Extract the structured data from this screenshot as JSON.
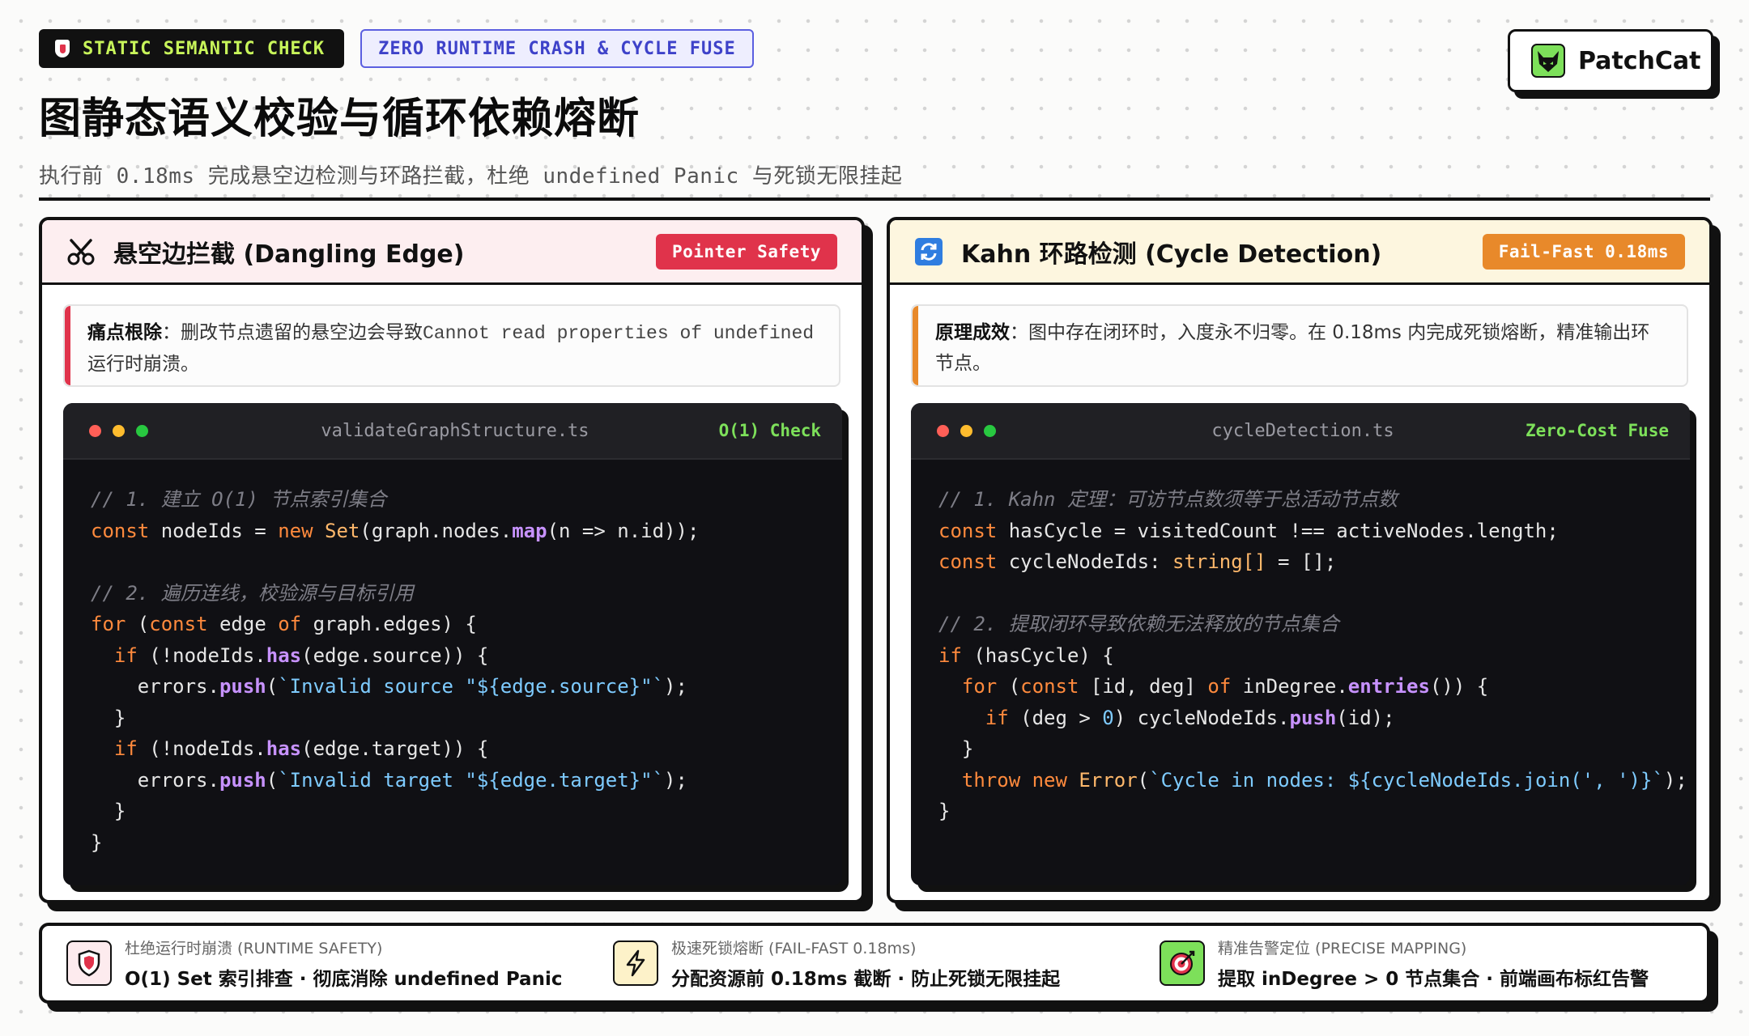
{
  "header": {
    "tag_primary": "STATIC SEMANTIC CHECK",
    "tag_secondary": "ZERO RUNTIME CRASH & CYCLE FUSE",
    "title": "图静态语义校验与循环依赖熔断",
    "subtitle": "执行前 0.18ms 完成悬空边检测与环路拦截，杜绝 undefined Panic 与死锁无限挂起"
  },
  "brand": {
    "name": "PatchCat",
    "icon": "fox-logo-icon",
    "accent": "#7de05a"
  },
  "cards": {
    "left": {
      "icon": "scissors-icon",
      "title": "悬空边拦截 (Dangling Edge)",
      "badge": "Pointer Safety",
      "note_bold": "痛点根除",
      "note_sep": "：",
      "note_text1": "删改节点遗留的悬空边会导致",
      "note_code": "Cannot read properties of undefined",
      "note_text2": "运行时崩溃。",
      "file_name": "validateGraphStructure.ts",
      "file_tag": "O(1) Check"
    },
    "right": {
      "icon": "refresh-cycle-icon",
      "title": "Kahn 环路检测 (Cycle Detection)",
      "badge": "Fail-Fast 0.18ms",
      "note_bold": "原理成效",
      "note_sep": "：",
      "note_text": "图中存在闭环时，入度永不归零。在 0.18ms 内完成死锁熔断，精准输出环节点。",
      "file_name": "cycleDetection.ts",
      "file_tag": "Zero-Cost Fuse"
    }
  },
  "footer": {
    "items": [
      {
        "icon": "shield-icon",
        "label": "杜绝运行时崩溃 (RUNTIME SAFETY)",
        "desc": "O(1) Set 索引排查 · 彻底消除 undefined Panic"
      },
      {
        "icon": "lightning-icon",
        "label": "极速死锁熔断 (FAIL-FAST 0.18ms)",
        "desc": "分配资源前 0.18ms 截断 · 防止死锁无限挂起"
      },
      {
        "icon": "target-icon",
        "label": "精准告警定位 (PRECISE MAPPING)",
        "desc": "提取 inDegree > 0 节点集合 · 前端画布标红告警"
      }
    ]
  },
  "colors": {
    "red": "#e0334b",
    "orange": "#e8892a",
    "indigo": "#5b5fe0",
    "green": "#7de05a"
  }
}
